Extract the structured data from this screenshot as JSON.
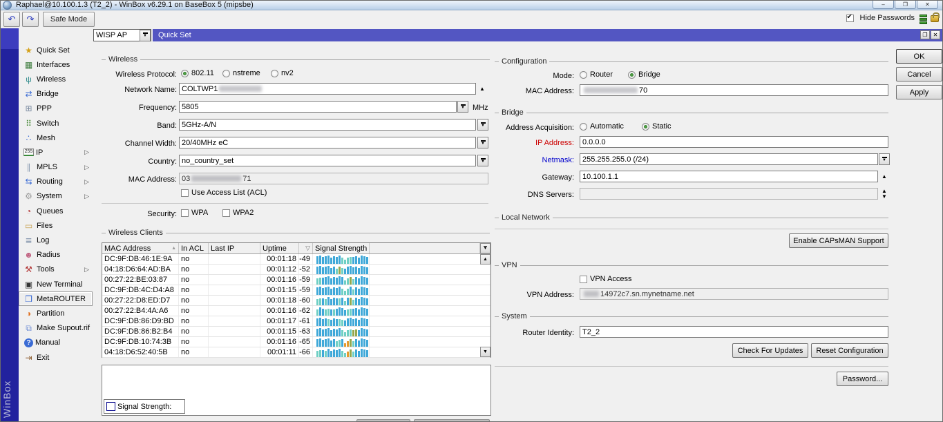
{
  "window": {
    "title": "Raphael@10.100.1.3 (T2_2) - WinBox v6.29.1 on BaseBox 5 (mipsbe)"
  },
  "icons": {
    "undo": "↶",
    "redo": "↷",
    "minimize": "–",
    "maximize": "❐",
    "close": "✕",
    "restore": "❐",
    "window_close": "✕",
    "dropdown": "▼",
    "up": "▲",
    "down": "▼",
    "sort_asc": "▲",
    "filter": "▽",
    "nav_arrow": "▷"
  },
  "toolbar": {
    "safe_mode": "Safe Mode",
    "hide_passwords": "Hide Passwords",
    "hide_passwords_checked": true
  },
  "sidebar": {
    "brand": "WinBox",
    "items": [
      {
        "label": "Quick Set",
        "icon": "magic-wand-icon",
        "glyph": "★",
        "color": "#d4a017",
        "arrow": false,
        "selected": false
      },
      {
        "label": "Interfaces",
        "icon": "interfaces-icon",
        "glyph": "▦",
        "color": "#3a7a3a",
        "arrow": false,
        "selected": false
      },
      {
        "label": "Wireless",
        "icon": "antenna-icon",
        "glyph": "ψ",
        "color": "#2e8b8b",
        "arrow": false,
        "selected": false
      },
      {
        "label": "Bridge",
        "icon": "bridge-icon",
        "glyph": "⇄",
        "color": "#3a6bd4",
        "arrow": false,
        "selected": false
      },
      {
        "label": "PPP",
        "icon": "ppp-icon",
        "glyph": "⊞",
        "color": "#7a8aa0",
        "arrow": false,
        "selected": false
      },
      {
        "label": "Switch",
        "icon": "switch-icon",
        "glyph": "⠿",
        "color": "#4a8b3a",
        "arrow": false,
        "selected": false
      },
      {
        "label": "Mesh",
        "icon": "mesh-icon",
        "glyph": "∴",
        "color": "#3a6bd4",
        "arrow": false,
        "selected": false
      },
      {
        "label": "IP",
        "icon": "ip-255-icon",
        "glyph": "255",
        "color": "#222",
        "arrow": true,
        "selected": false,
        "special": "ip"
      },
      {
        "label": "MPLS",
        "icon": "mpls-icon",
        "glyph": "∥",
        "color": "#8a9ab0",
        "arrow": true,
        "selected": false
      },
      {
        "label": "Routing",
        "icon": "routing-icon",
        "glyph": "⇆",
        "color": "#3a6bd4",
        "arrow": true,
        "selected": false
      },
      {
        "label": "System",
        "icon": "gear-icon",
        "glyph": "⚙",
        "color": "#9a9a9a",
        "arrow": true,
        "selected": false
      },
      {
        "label": "Queues",
        "icon": "queues-icon",
        "glyph": "◔",
        "color": "#b03030",
        "arrow": false,
        "selected": false
      },
      {
        "label": "Files",
        "icon": "folder-icon",
        "glyph": "▭",
        "color": "#c8a050",
        "arrow": false,
        "selected": false
      },
      {
        "label": "Log",
        "icon": "log-icon",
        "glyph": "≣",
        "color": "#8a9ab0",
        "arrow": false,
        "selected": false
      },
      {
        "label": "Radius",
        "icon": "users-icon",
        "glyph": "☻",
        "color": "#c06080",
        "arrow": false,
        "selected": false
      },
      {
        "label": "Tools",
        "icon": "tools-icon",
        "glyph": "⚒",
        "color": "#b03030",
        "arrow": true,
        "selected": false
      },
      {
        "label": "New Terminal",
        "icon": "terminal-icon",
        "glyph": "▣",
        "color": "#333333",
        "arrow": false,
        "selected": false
      },
      {
        "label": "MetaROUTER",
        "icon": "metarouter-icon",
        "glyph": "❒",
        "color": "#3a6bd4",
        "arrow": false,
        "selected": true
      },
      {
        "label": "Partition",
        "icon": "partition-icon",
        "glyph": "◑",
        "color": "#e07020",
        "arrow": false,
        "selected": false
      },
      {
        "label": "Make Supout.rif",
        "icon": "document-icon",
        "glyph": "⧉",
        "color": "#6a8ad4",
        "arrow": false,
        "selected": false
      },
      {
        "label": "Manual",
        "icon": "help-icon",
        "glyph": "?",
        "color": "#ffffff",
        "arrow": false,
        "selected": false,
        "special": "manual"
      },
      {
        "label": "Exit",
        "icon": "exit-door-icon",
        "glyph": "⇥",
        "color": "#8b5a2b",
        "arrow": false,
        "selected": false
      }
    ]
  },
  "quickset": {
    "mode_selector": "WISP AP",
    "window_title": "Quick Set",
    "buttons": {
      "ok": "OK",
      "cancel": "Cancel",
      "apply": "Apply"
    },
    "wireless": {
      "legend": "Wireless",
      "protocol_label": "Wireless Protocol:",
      "protocol_options": [
        "802.11",
        "nstreme",
        "nv2"
      ],
      "protocol_selected": "802.11",
      "network_name_label": "Network Name:",
      "network_name_value": "COLTWP1",
      "network_name_redacted": true,
      "frequency_label": "Frequency:",
      "frequency_value": "5805",
      "frequency_unit": "MHz",
      "band_label": "Band:",
      "band_value": "5GHz-A/N",
      "channel_width_label": "Channel Width:",
      "channel_width_value": "20/40MHz eC",
      "country_label": "Country:",
      "country_value": "no_country_set",
      "mac_label": "MAC Address:",
      "mac_prefix": "03",
      "mac_suffix": "71",
      "mac_redacted": true,
      "acl_label": "Use Access List (ACL)",
      "acl_checked": false,
      "security_label": "Security:",
      "wpa_label": "WPA",
      "wpa_checked": false,
      "wpa2_label": "WPA2",
      "wpa2_checked": false
    },
    "clients": {
      "legend": "Wireless Clients",
      "columns": [
        "MAC Address",
        "In ACL",
        "Last IP",
        "Uptime",
        "Signal Strength"
      ],
      "rows": [
        {
          "mac": "DC:9F:DB:46:1E:9A",
          "in_acl": "no",
          "last_ip": "",
          "uptime": "00:01:18",
          "signal": "-49",
          "bars": "bbbbbbbbbttttbbbbbbb"
        },
        {
          "mac": "04:18:D6:64:AD:BA",
          "in_acl": "no",
          "last_ip": "",
          "uptime": "00:01:12",
          "signal": "-52",
          "bars": "bbbbbbbtgtbbbbbbbbbb"
        },
        {
          "mac": "00:27:22:BE:03:87",
          "in_acl": "no",
          "last_ip": "",
          "uptime": "00:01:16",
          "signal": "-59",
          "bars": "ttbbbbbbbbttgtbbbbbb"
        },
        {
          "mac": "DC:9F:DB:4C:D4:A8",
          "in_acl": "no",
          "last_ip": "",
          "uptime": "00:01:15",
          "signal": "-59",
          "bars": "bbbbbbbbbtttbtbbbbbb"
        },
        {
          "mac": "00:27:22:D8:ED:D7",
          "in_acl": "no",
          "last_ip": "",
          "uptime": "00:01:18",
          "signal": "-60",
          "bars": "ttbtbbbbtbtbgtbbbbbb"
        },
        {
          "mac": "00:27:22:B4:4A:A6",
          "in_acl": "no",
          "last_ip": "",
          "uptime": "00:01:16",
          "signal": "-62",
          "bars": "tbbttbtbbbbttbbbbbbb"
        },
        {
          "mac": "DC:9F:DB:86:D9:BD",
          "in_acl": "no",
          "last_ip": "",
          "uptime": "00:01:17",
          "signal": "-61",
          "bars": "bbbbtbbbttbbbbbbbbbb"
        },
        {
          "mac": "DC:9F:DB:86:B2:B4",
          "in_acl": "no",
          "last_ip": "",
          "uptime": "00:01:15",
          "signal": "-63",
          "bars": "bbbbbbbbbttttggbbbbb"
        },
        {
          "mac": "DC:9F:DB:10:74:3B",
          "in_acl": "no",
          "last_ip": "",
          "uptime": "00:01:16",
          "signal": "-65",
          "bars": "bbbbbbbttboogtbbbbbb"
        },
        {
          "mac": "04:18:D6:52:40:5B",
          "in_acl": "no",
          "last_ip": "",
          "uptime": "00:01:11",
          "signal": "-66",
          "bars": "ttbtbbbbbttogtbbbbbb"
        }
      ],
      "bar_colors": {
        "b": "#3fa8d8",
        "t": "#6fcfc4",
        "g": "#93a84e",
        "o": "#e59a2e"
      }
    },
    "signal_chart": {
      "legend_label": "Signal Strength:",
      "legend_color": "#0000dd"
    },
    "configuration": {
      "legend": "Configuration",
      "mode_label": "Mode:",
      "mode_options": [
        "Router",
        "Bridge"
      ],
      "mode_selected": "Bridge",
      "mac_label": "MAC Address:",
      "mac_suffix": "70",
      "mac_redacted": true
    },
    "bridge": {
      "legend": "Bridge",
      "acquisition_label": "Address Acquisition:",
      "acquisition_options": [
        "Automatic",
        "Static"
      ],
      "acquisition_selected": "Static",
      "ip_label": "IP Address:",
      "ip_label_color": "#cc0000",
      "ip_value": "0.0.0.0",
      "netmask_label": "Netmask:",
      "netmask_label_color": "#0000cc",
      "netmask_value": "255.255.255.0 (/24)",
      "gateway_label": "Gateway:",
      "gateway_value": "10.100.1.1",
      "dns_label": "DNS Servers:",
      "dns_value": ""
    },
    "local_network": {
      "legend": "Local Network",
      "capsman_button": "Enable CAPsMAN Support"
    },
    "vpn": {
      "legend": "VPN",
      "access_label": "VPN Access",
      "access_checked": false,
      "address_label": "VPN Address:",
      "address_suffix": "14972c7.sn.mynetname.net",
      "address_redacted": true
    },
    "system": {
      "legend": "System",
      "identity_label": "Router Identity:",
      "identity_value": "T2_2",
      "check_updates_button": "Check For Updates",
      "reset_config_button": "Reset Configuration",
      "password_button": "Password..."
    }
  }
}
